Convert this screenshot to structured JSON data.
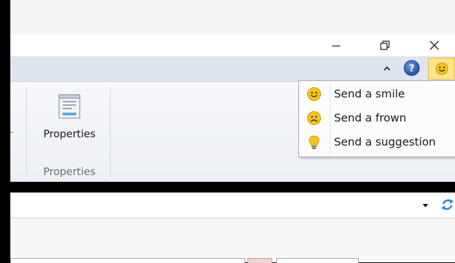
{
  "ribbon": {
    "properties_button_label": "Properties",
    "group_label": "Properties"
  },
  "window_controls": {
    "minimize_icon": "minimize-icon",
    "restore_icon": "restore-icon",
    "close_icon": "close-icon"
  },
  "ribbon_tabs": {
    "collapse_icon": "chevron-up-icon",
    "help_icon": "help-icon",
    "feedback_icon": "smiley-icon"
  },
  "feedback_menu": {
    "items": [
      {
        "label": "Send a smile",
        "icon": "smile-icon"
      },
      {
        "label": "Send a frown",
        "icon": "frown-icon"
      },
      {
        "label": "Send a suggestion",
        "icon": "lightbulb-icon"
      }
    ]
  },
  "address_bar": {
    "dropdown_icon": "dropdown-arrow-icon",
    "refresh_icon": "refresh-icon"
  },
  "colors": {
    "accent_blue": "#2b5fb3",
    "feedback_yellow": "#f5c518",
    "ribbon_tab_bg": "#dfe5ee"
  }
}
